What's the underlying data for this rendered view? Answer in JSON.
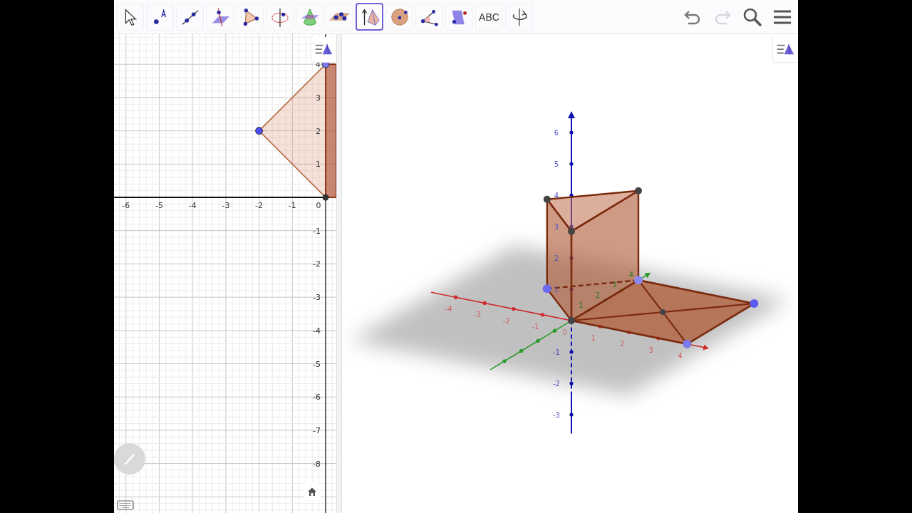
{
  "toolbar": {
    "tools": [
      {
        "kind": "move",
        "selected": false
      },
      {
        "kind": "point",
        "selected": false
      },
      {
        "kind": "line",
        "selected": false
      },
      {
        "kind": "perpendicular",
        "selected": false
      },
      {
        "kind": "polygon",
        "selected": false
      },
      {
        "kind": "rotate-line",
        "selected": false
      },
      {
        "kind": "intersect",
        "selected": false
      },
      {
        "kind": "plane",
        "selected": false
      },
      {
        "kind": "pyramid",
        "selected": true
      },
      {
        "kind": "sphere",
        "selected": false
      },
      {
        "kind": "angle",
        "selected": false
      },
      {
        "kind": "reflect",
        "selected": false
      },
      {
        "kind": "text",
        "label": "ABC",
        "selected": false
      },
      {
        "kind": "rotate-view",
        "selected": false
      }
    ],
    "undo": {
      "disabled": false
    },
    "redo": {
      "disabled": true
    }
  },
  "graphics_2d": {
    "x_labels": [
      "-6",
      "-5",
      "-4",
      "-3",
      "-2",
      "-1"
    ],
    "origin_label": "0",
    "y_labels": [
      "4",
      "3",
      "2",
      "1",
      "-1",
      "-2",
      "-3",
      "-4",
      "-5",
      "-6",
      "-7",
      "-8"
    ]
  },
  "graphics_3d": {
    "x_labels": [
      "-4",
      "-3",
      "-2",
      "-1",
      "1",
      "2",
      "3",
      "4"
    ],
    "y_labels": [
      "1",
      "2",
      "3",
      "4"
    ],
    "z_labels": [
      "6",
      "5",
      "4",
      "3",
      "2",
      "1",
      "-1",
      "-2",
      "-3"
    ],
    "origin_label": "0"
  }
}
